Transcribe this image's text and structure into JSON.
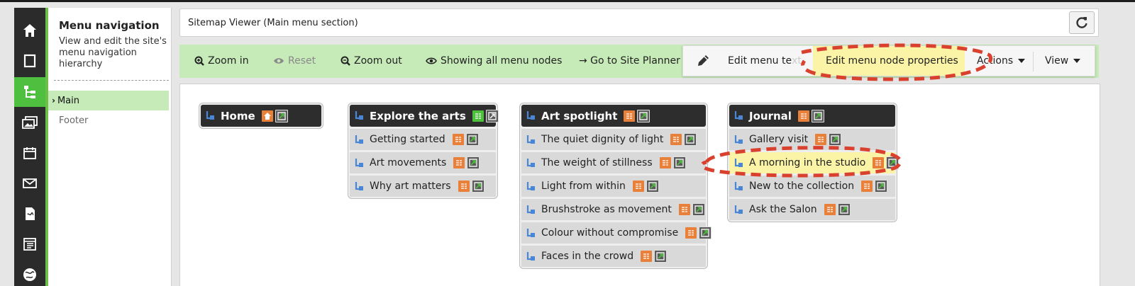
{
  "nav": {
    "icons": [
      "home-icon",
      "page-icon",
      "sitemap-icon",
      "media-icon",
      "calendar-icon",
      "mail-icon",
      "form-icon",
      "layout-icon",
      "globe-icon"
    ],
    "active_icon": "sitemap-icon",
    "title": "Menu navigation",
    "description": "View and edit the site's menu navigation hierarchy",
    "menus": [
      {
        "label": "Main",
        "selected": true
      },
      {
        "label": "Footer",
        "selected": false
      }
    ]
  },
  "titlebar": {
    "title": "Sitemap Viewer (Main menu section)",
    "refresh_icon": "refresh-icon"
  },
  "toolbar": {
    "zoom_in": "Zoom in",
    "reset": "Reset",
    "zoom_out": "Zoom out",
    "showing": "Showing all menu nodes",
    "go_to_site_planner": "→ Go to Site Planner t"
  },
  "floatmenu": {
    "edit_menu_text": "Edit menu te",
    "edit_menu_text_tail": "xt",
    "edit_node_properties": "Edit menu node properties",
    "actions": "Actions",
    "view": "View"
  },
  "sitemap": {
    "groups": [
      {
        "title": "Home",
        "items": []
      },
      {
        "title": "Explore the arts",
        "items": [
          "Getting started",
          "Art movements",
          "Why art matters"
        ]
      },
      {
        "title": "Art spotlight",
        "items": [
          "The quiet dignity of light",
          "The weight of stillness",
          "Light from within",
          "Brushstroke as movement",
          "Colour without compromise",
          "Faces in the crowd"
        ]
      },
      {
        "title": "Journal",
        "items": [
          "Gallery visit",
          "A morning in the studio",
          "New to the collection",
          "Ask the Salon"
        ]
      }
    ],
    "highlighted_item": "A morning in the studio"
  },
  "colors": {
    "accent_green": "#4fbf3f",
    "toolbar_green": "#c6eab8",
    "highlight_yellow": "#fbf4a6",
    "annotation_red": "#d9412e",
    "page_badge_orange": "#e8803a"
  }
}
